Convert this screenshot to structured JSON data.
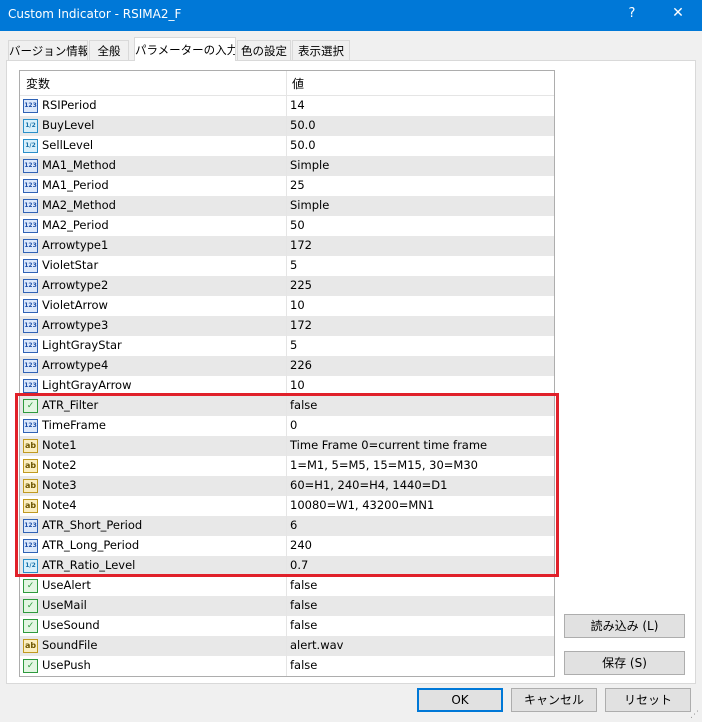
{
  "window": {
    "title": "Custom Indicator - RSIMA2_F",
    "help_glyph": "?",
    "close_glyph": "✕"
  },
  "tabs": [
    {
      "label": "バージョン情報",
      "active": false
    },
    {
      "label": "全般",
      "active": false
    },
    {
      "label": "パラメーターの入力",
      "active": true
    },
    {
      "label": "色の設定",
      "active": false
    },
    {
      "label": "表示選択",
      "active": false
    }
  ],
  "grid": {
    "columns": {
      "name": "変数",
      "value": "値"
    },
    "rows": [
      {
        "type": "int",
        "icon": "123",
        "name": "RSIPeriod",
        "value": "14"
      },
      {
        "type": "dbl",
        "icon": "1/2",
        "name": "BuyLevel",
        "value": "50.0"
      },
      {
        "type": "dbl",
        "icon": "1/2",
        "name": "SellLevel",
        "value": "50.0"
      },
      {
        "type": "int",
        "icon": "123",
        "name": "MA1_Method",
        "value": "Simple"
      },
      {
        "type": "int",
        "icon": "123",
        "name": "MA1_Period",
        "value": "25"
      },
      {
        "type": "int",
        "icon": "123",
        "name": "MA2_Method",
        "value": "Simple"
      },
      {
        "type": "int",
        "icon": "123",
        "name": "MA2_Period",
        "value": "50"
      },
      {
        "type": "int",
        "icon": "123",
        "name": "Arrowtype1",
        "value": "172"
      },
      {
        "type": "int",
        "icon": "123",
        "name": "VioletStar",
        "value": "5"
      },
      {
        "type": "int",
        "icon": "123",
        "name": "Arrowtype2",
        "value": "225"
      },
      {
        "type": "int",
        "icon": "123",
        "name": "VioletArrow",
        "value": "10"
      },
      {
        "type": "int",
        "icon": "123",
        "name": "Arrowtype3",
        "value": "172"
      },
      {
        "type": "int",
        "icon": "123",
        "name": "LightGrayStar",
        "value": "5"
      },
      {
        "type": "int",
        "icon": "123",
        "name": "Arrowtype4",
        "value": "226"
      },
      {
        "type": "int",
        "icon": "123",
        "name": "LightGrayArrow",
        "value": "10"
      },
      {
        "type": "bool",
        "icon": "✓",
        "name": "ATR_Filter",
        "value": "false"
      },
      {
        "type": "int",
        "icon": "123",
        "name": "TimeFrame",
        "value": "0"
      },
      {
        "type": "str",
        "icon": "ab",
        "name": "Note1",
        "value": "Time Frame 0=current time frame"
      },
      {
        "type": "str",
        "icon": "ab",
        "name": "Note2",
        "value": "1=M1, 5=M5, 15=M15, 30=M30"
      },
      {
        "type": "str",
        "icon": "ab",
        "name": "Note3",
        "value": "60=H1, 240=H4, 1440=D1"
      },
      {
        "type": "str",
        "icon": "ab",
        "name": "Note4",
        "value": "10080=W1, 43200=MN1"
      },
      {
        "type": "int",
        "icon": "123",
        "name": "ATR_Short_Period",
        "value": "6"
      },
      {
        "type": "int",
        "icon": "123",
        "name": "ATR_Long_Period",
        "value": "240"
      },
      {
        "type": "dbl",
        "icon": "1/2",
        "name": "ATR_Ratio_Level",
        "value": "0.7"
      },
      {
        "type": "bool",
        "icon": "✓",
        "name": "UseAlert",
        "value": "false"
      },
      {
        "type": "bool",
        "icon": "✓",
        "name": "UseMail",
        "value": "false"
      },
      {
        "type": "bool",
        "icon": "✓",
        "name": "UseSound",
        "value": "false"
      },
      {
        "type": "str",
        "icon": "ab",
        "name": "SoundFile",
        "value": "alert.wav"
      },
      {
        "type": "bool",
        "icon": "✓",
        "name": "UsePush",
        "value": "false"
      }
    ]
  },
  "side_buttons": {
    "load": "読み込み (L)",
    "save": "保存 (S)"
  },
  "footer_buttons": {
    "ok": "OK",
    "cancel": "キャンセル",
    "reset": "リセット"
  },
  "highlight_color": "#e0202a"
}
